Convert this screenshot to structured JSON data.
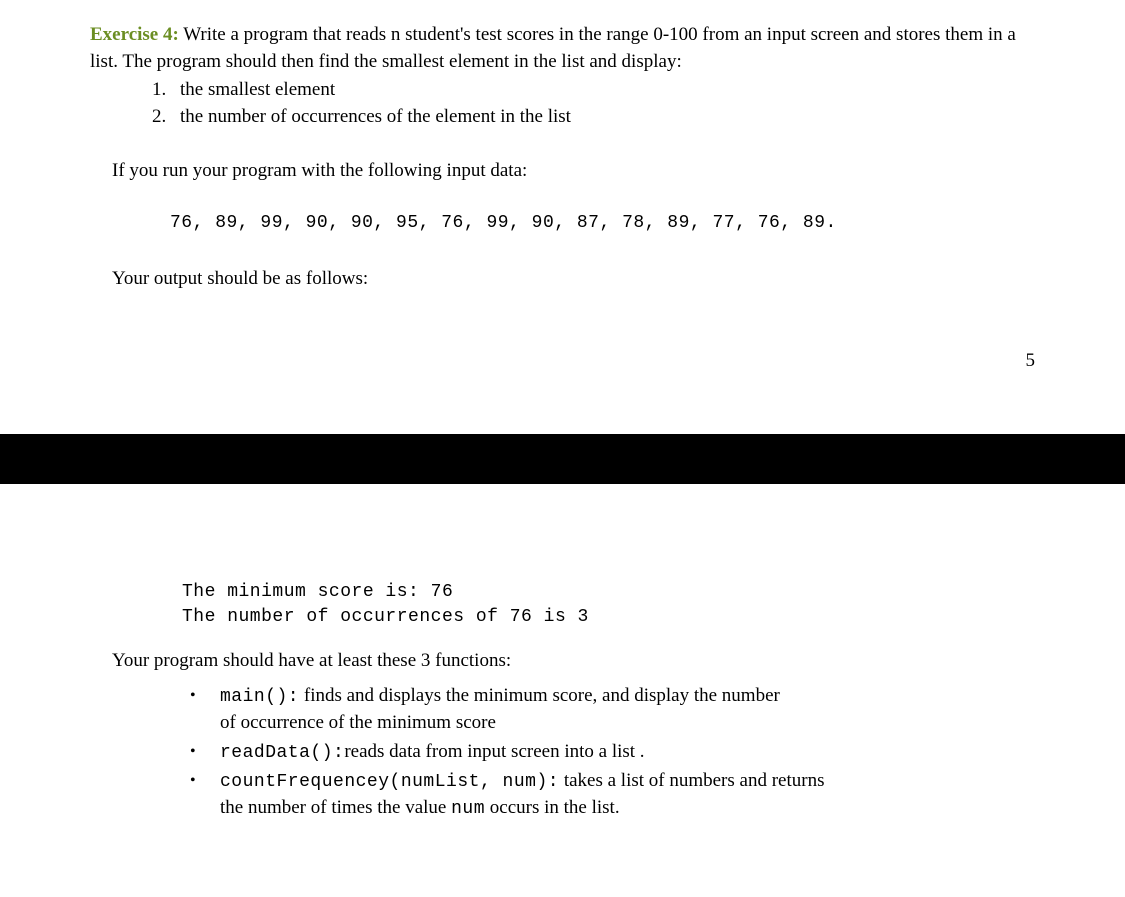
{
  "exercise": {
    "label": "Exercise 4:",
    "intro": "Write a program that reads n student's test scores in the range 0-100 from an input screen  and stores them in a list. The program should then find the smallest element in the list and display:",
    "items": [
      {
        "num": "1.",
        "text": "the smallest element"
      },
      {
        "num": "2.",
        "text": "the number of occurrences of the element in the list"
      }
    ],
    "run_text": "If you run your program with the following input data:",
    "input_data": "76, 89, 99, 90, 90, 95, 76, 99, 90, 87, 78, 89, 77, 76, 89.",
    "output_label": "Your output should be as follows:",
    "page_number": "5",
    "output_lines": [
      "The minimum score is: 76",
      "The number of occurrences of 76 is 3"
    ],
    "functions_label": "Your program should have at least these 3 functions:",
    "functions": [
      {
        "code": "main():",
        "desc_a": " finds and displays the minimum score, and display the number",
        "desc_b": "of occurrence of the minimum score"
      },
      {
        "code": "readData():",
        "desc_a": "reads data from input screen into a list .",
        "desc_b": ""
      },
      {
        "code": "countFrequencey(numList, num):",
        "desc_a": " takes a list of numbers and returns",
        "desc_b": "the number of times the value ",
        "code_b": "num",
        "desc_c": "  occurs in the list."
      }
    ]
  }
}
